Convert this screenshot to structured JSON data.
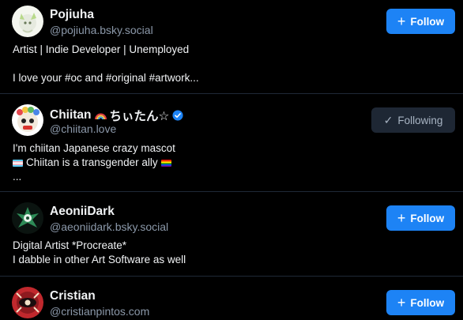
{
  "colors": {
    "background": "#000000",
    "follow_button": "#1d83f5",
    "following_button": "#1e2734",
    "verified": "#1d83f5"
  },
  "profiles": [
    {
      "display_name": "Pojiuha",
      "handle": "@pojiuha.bsky.social",
      "bio_lines": [
        "Artist | Indie Developer | Unemployed",
        "",
        "I love your #oc and #original #artwork..."
      ],
      "button": {
        "label": "Follow",
        "icon": "plus-icon",
        "state": "follow"
      }
    },
    {
      "display_name": "Chiitan",
      "name_suffix": "ちぃたん☆",
      "name_emoji": "rainbow-icon",
      "verified": true,
      "handle": "@chiitan.love",
      "bio_lines": [
        "I'm chiitan Japanese crazy mascot",
        "Chiitan is a transgender ally",
        "..."
      ],
      "button": {
        "label": "Following",
        "icon": "check-icon",
        "state": "following"
      }
    },
    {
      "display_name": "AeoniiDark",
      "handle": "@aeoniidark.bsky.social",
      "bio_lines": [
        "Digital Artist *Procreate*",
        "I dabble in other Art Software as well"
      ],
      "button": {
        "label": "Follow",
        "icon": "plus-icon",
        "state": "follow"
      }
    },
    {
      "display_name": "Cristian",
      "handle": "@cristianpintos.com",
      "bio_lines": [],
      "button": {
        "label": "Follow",
        "icon": "plus-icon",
        "state": "follow"
      }
    }
  ]
}
